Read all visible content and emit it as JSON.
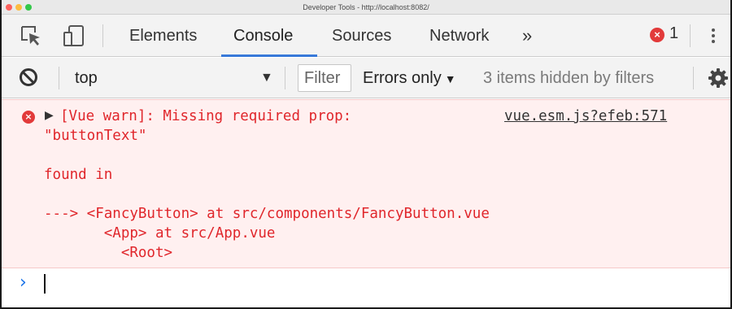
{
  "window": {
    "title": "Developer Tools - http://localhost:8082/"
  },
  "tabs": {
    "items": [
      "Elements",
      "Console",
      "Sources",
      "Network"
    ],
    "active": "Console",
    "more_label": "»",
    "error_count": "1"
  },
  "toolbar": {
    "context": "top",
    "context_caret": "▼",
    "filter_placeholder": "Filter",
    "level": "Errors only",
    "level_caret": "▼",
    "hidden_info": "3 items hidden by filters"
  },
  "message": {
    "expand_glyph": "▶",
    "lines": [
      "[Vue warn]: Missing required prop:",
      "\"buttonText\"",
      "found in",
      "---> <FancyButton> at src/components/FancyButton.vue",
      "       <App> at src/App.vue",
      "         <Root>"
    ],
    "source": "vue.esm.js?efeb:571"
  },
  "prompt": {
    "chevron": "›"
  },
  "icons": {
    "inspect": "inspect-element-icon",
    "device": "device-toolbar-icon",
    "more": "kebab-menu-icon",
    "clear": "clear-console-icon",
    "settings": "gear-icon",
    "error": "error-icon"
  },
  "colors": {
    "accent": "#3879d9",
    "error": "#e0262b",
    "error_bg": "#fff0f0"
  }
}
